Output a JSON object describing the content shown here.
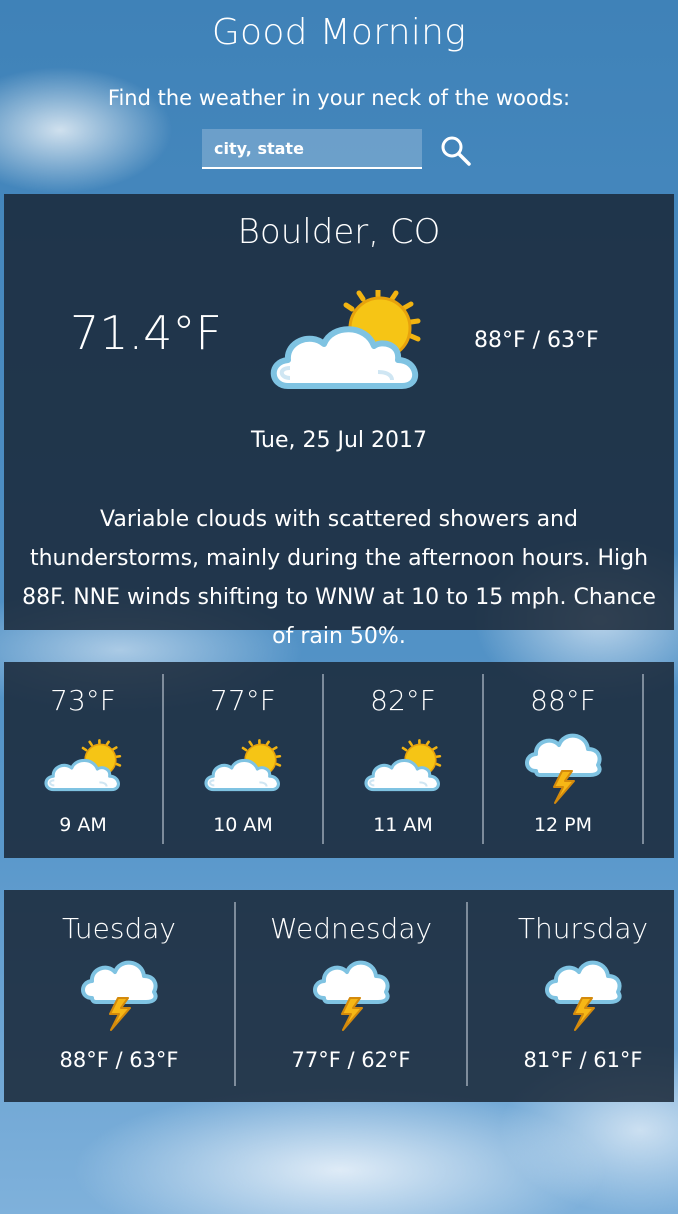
{
  "header": {
    "greeting": "Good Morning",
    "tagline": "Find the weather in your neck of the woods:",
    "search_placeholder": "city, state",
    "search_icon": "search-icon"
  },
  "current": {
    "city": "Boulder, CO",
    "temp": "71.4°F",
    "hilo": "88°F / 63°F",
    "icon": "partly-cloudy-icon",
    "date": "Tue, 25 Jul 2017",
    "description": "Variable clouds with scattered showers and thunderstorms, mainly during the afternoon hours. High 88F. NNE winds shifting to WNW at 10 to 15 mph. Chance of rain 50%."
  },
  "hourly": [
    {
      "temp": "73°F",
      "time": "9 AM",
      "icon": "partly-cloudy-icon"
    },
    {
      "temp": "77°F",
      "time": "10 AM",
      "icon": "partly-cloudy-icon"
    },
    {
      "temp": "82°F",
      "time": "11 AM",
      "icon": "partly-cloudy-icon"
    },
    {
      "temp": "88°F",
      "time": "12 PM",
      "icon": "thunderstorm-icon"
    }
  ],
  "daily": [
    {
      "day": "Tuesday",
      "hilo": "88°F / 63°F",
      "icon": "thunderstorm-icon"
    },
    {
      "day": "Wednesday",
      "hilo": "77°F / 62°F",
      "icon": "thunderstorm-icon"
    },
    {
      "day": "Thursday",
      "hilo": "81°F / 61°F",
      "icon": "thunderstorm-icon"
    }
  ]
}
